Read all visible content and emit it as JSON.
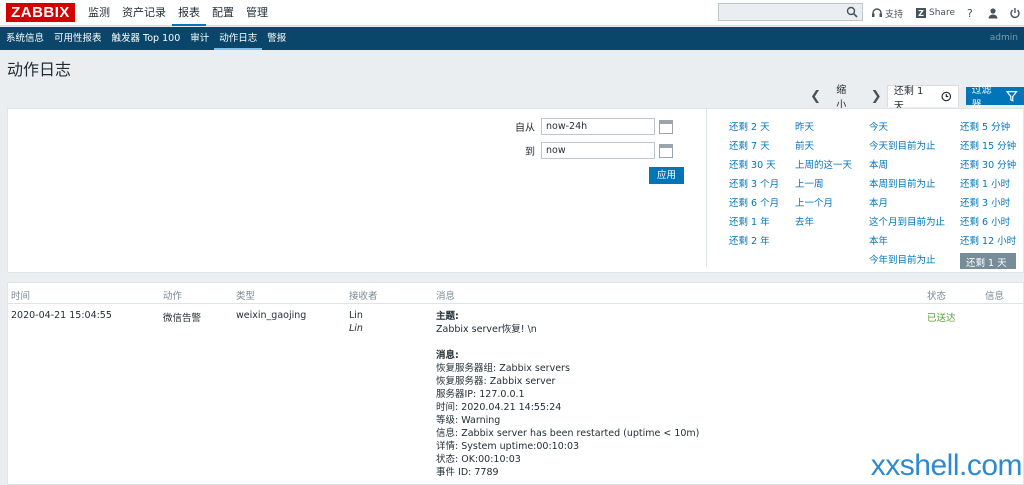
{
  "logo": "ZABBIX",
  "main_nav": [
    "监测",
    "资产记录",
    "报表",
    "配置",
    "管理"
  ],
  "top_links": {
    "support": "支持",
    "share": "Share",
    "help": "?"
  },
  "sub_nav": [
    "系统信息",
    "可用性报表",
    "触发器 Top 100",
    "审计",
    "动作日志",
    "警报"
  ],
  "user": "admin",
  "page_title": "动作日志",
  "filter_tabs": {
    "zoom": "缩小",
    "current": "还剩 1 天",
    "filter": "过滤器"
  },
  "filter": {
    "from_label": "自从",
    "from_value": "now-24h",
    "to_label": "到",
    "to_value": "now",
    "apply": "应用"
  },
  "quick_ranges": [
    [
      "还剩 2 天",
      "还剩 7 天",
      "还剩 30 天",
      "还剩 3 个月",
      "还剩 6 个月",
      "还剩 1 年",
      "还剩 2 年"
    ],
    [
      "昨天",
      "前天",
      "上周的这一天",
      "上一周",
      "上一个月",
      "去年"
    ],
    [
      "今天",
      "今天到目前为止",
      "本周",
      "本周到目前为止",
      "本月",
      "这个月到目前为止",
      "本年",
      "今年到目前为止"
    ],
    [
      "还剩 5 分钟",
      "还剩 15 分钟",
      "还剩 30 分钟",
      "还剩 1 小时",
      "还剩 3 小时",
      "还剩 6 小时",
      "还剩 12 小时",
      "还剩 1 天"
    ]
  ],
  "table": {
    "headers": [
      "时间",
      "动作",
      "类型",
      "接收者",
      "消息",
      "状态",
      "信息"
    ],
    "row": {
      "time": "2020-04-21 15:04:55",
      "action": "微信告警",
      "type": "weixin_gaojing",
      "recipient": "Lin",
      "recipient_sub": "Lin",
      "status": "已送达",
      "message": {
        "subject_label": "主题:",
        "subject": "Zabbix server恢复! \\n",
        "body_label": "消息:",
        "lines": [
          "恢复服务器组: Zabbix servers",
          "恢复服务器: Zabbix server",
          "服务器IP: 127.0.0.1",
          "时间: 2020.04.21 14:55:24",
          "等级: Warning",
          "信息: Zabbix server has been restarted (uptime < 10m)",
          "详情: System uptime:00:10:03",
          "状态: OK:00:10:03",
          "事件 ID: 7789"
        ]
      }
    }
  },
  "watermark": "xxshell.com",
  "colors": {
    "brand": "#d40000",
    "accent": "#0275b8",
    "subnav": "#0a466a",
    "sent": "#59a13d"
  }
}
